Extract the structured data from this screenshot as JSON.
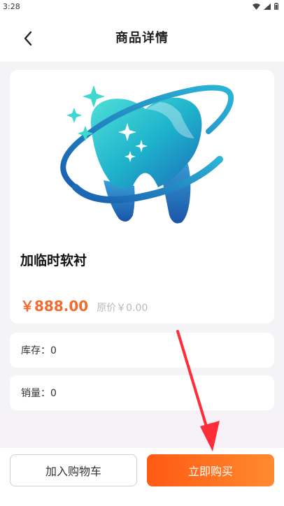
{
  "status_bar": {
    "time": "3:28",
    "icons": [
      "wifi-icon",
      "signal-icon",
      "battery-icon"
    ]
  },
  "header": {
    "title": "商品详情",
    "back_icon": "chevron-left-icon"
  },
  "product": {
    "name": "加临时软衬",
    "price": "￥888.00",
    "original_price": "原价￥0.00",
    "image_icon": "tooth-logo-icon"
  },
  "details": {
    "stock": "库存：0",
    "sales": "销量：0"
  },
  "actions": {
    "add_to_cart": "加入购物车",
    "buy_now": "立即购买"
  },
  "colors": {
    "price": "#f26a2e",
    "buy_gradient_start": "#ff5a14",
    "buy_gradient_end": "#ff8a2e",
    "annotation_arrow": "#ff2d3a"
  }
}
